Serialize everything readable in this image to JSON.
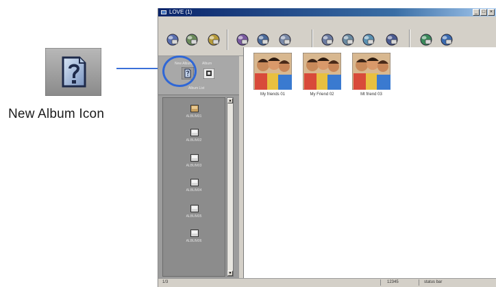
{
  "callout": {
    "label": "New Album  Icon"
  },
  "window": {
    "title": "LOVE (1)",
    "controls": [
      "_",
      "□",
      "×"
    ]
  },
  "toolbar": {
    "buttons": [
      {
        "icon": "globe-icon",
        "color": "#5a6fb0"
      },
      {
        "icon": "album-icon",
        "color": "#6a8a5a"
      },
      {
        "icon": "photo-edit-icon",
        "color": "#b59a3a"
      },
      {
        "icon": "people-icon",
        "color": "#7a5aa0"
      },
      {
        "icon": "camera-icon",
        "color": "#4a6a9a"
      },
      {
        "icon": "print-icon",
        "color": "#7a8aa8"
      },
      {
        "icon": "settings-icon",
        "color": "#6a7aa0"
      },
      {
        "icon": "tools-icon",
        "color": "#6a8aa0"
      },
      {
        "icon": "send-icon",
        "color": "#5a90b0"
      },
      {
        "icon": "sound-icon",
        "color": "#4a5a90"
      },
      {
        "icon": "help-icon",
        "color": "#3a8a5a"
      },
      {
        "icon": "user-icon",
        "color": "#3a6ab0"
      }
    ]
  },
  "panel": {
    "new_album_caption": "New Album",
    "tiny_caption_right": "Album",
    "list_caption": "Album List"
  },
  "albums": [
    {
      "label": "ALBUM01"
    },
    {
      "label": "ALBUM02"
    },
    {
      "label": "ALBUM03"
    },
    {
      "label": "ALBUM04"
    },
    {
      "label": "ALBUM05"
    },
    {
      "label": "ALBUM06"
    }
  ],
  "photos": [
    {
      "caption": "My friends 01"
    },
    {
      "caption": "My Friend 02"
    },
    {
      "caption": "Mt friend 03"
    }
  ],
  "status": {
    "left": "1/3",
    "middle": "12345",
    "right": "status bar"
  },
  "colors": {
    "highlight": "#2f67d6",
    "titlebar": "#0a246a",
    "panel": "#9c9c9c"
  }
}
